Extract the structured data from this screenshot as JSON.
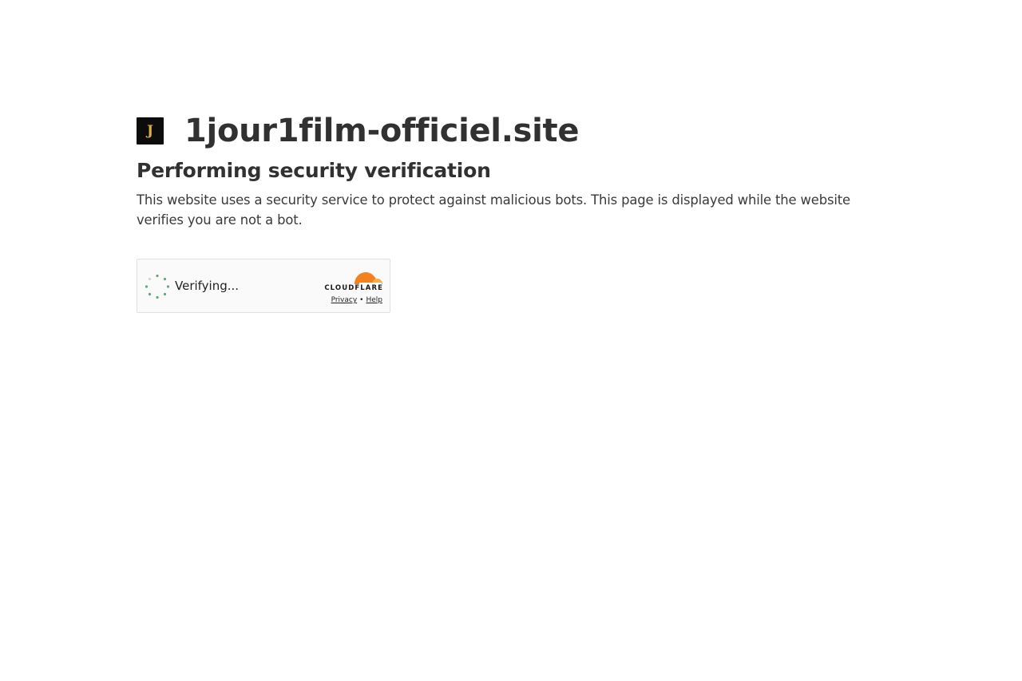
{
  "site": {
    "favicon_letter": "J",
    "name": "1jour1film-officiel.site"
  },
  "challenge": {
    "heading": "Performing security verification",
    "description": "This website uses a security service to protect against malicious bots. This page is displayed while the website verifies you are not a bot."
  },
  "widget": {
    "status": "Verifying...",
    "spinner_icon": "loading-spinner-icon",
    "brand": "CLOUDFLARE",
    "brand_icon": "cloudflare-cloud-icon",
    "privacy_label": "Privacy",
    "separator": "•",
    "help_label": "Help"
  },
  "colors": {
    "spinner": "#5ea87a",
    "cloudflare_orange": "#f48120",
    "cloudflare_light_orange": "#faad3f",
    "favicon_bg": "#0c0c0c",
    "favicon_letter": "#d8ae47"
  }
}
